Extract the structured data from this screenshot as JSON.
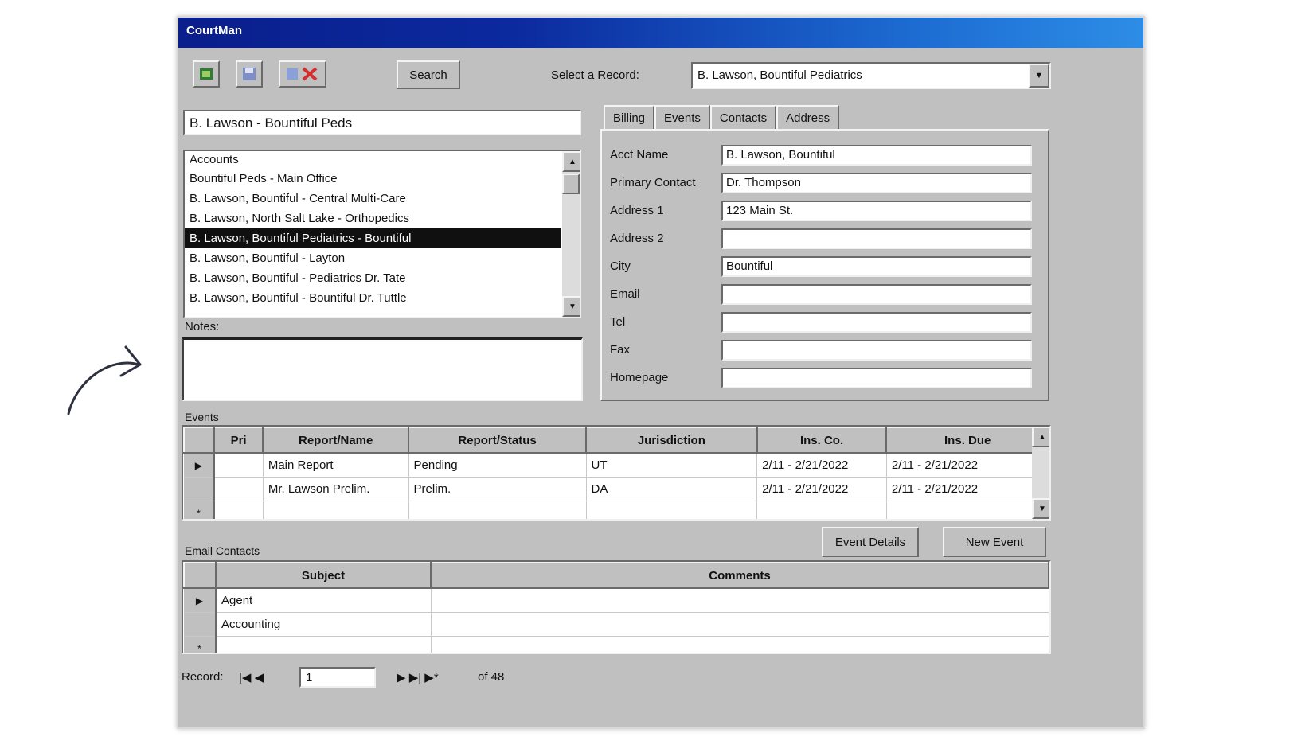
{
  "window": {
    "title": "CourtMan"
  },
  "toolbar": {
    "icons": [
      "new-record-icon",
      "save-icon",
      "delete-icon"
    ],
    "search_button": "Search",
    "select_label": "Select a Record:",
    "select_value": "B. Lawson, Bountiful Pediatrics"
  },
  "left_panel": {
    "name_value": "B. Lawson - Bountiful Peds",
    "list_header": "Accounts",
    "list_items": [
      "Bountiful Peds - Main Office",
      "B. Lawson, Bountiful - Central Multi-Care",
      "B. Lawson, North Salt Lake - Orthopedics",
      "B. Lawson, Bountiful Pediatrics - Bountiful",
      "B. Lawson, Bountiful - Layton",
      "B. Lawson, Bountiful - Pediatrics Dr. Tate",
      "B. Lawson, Bountiful - Bountiful Dr. Tuttle"
    ],
    "selected_index": 3,
    "notes_label": "Notes:",
    "notes_value": ""
  },
  "tabs": [
    "Billing",
    "Events",
    "Contacts",
    "Address"
  ],
  "contact_form": {
    "fields": [
      {
        "label": "Acct Name",
        "value": "B. Lawson, Bountiful"
      },
      {
        "label": "Primary Contact",
        "value": "Dr. Thompson"
      },
      {
        "label": "Address 1",
        "value": "123 Main St."
      },
      {
        "label": "Address 2",
        "value": ""
      },
      {
        "label": "City",
        "value": "Bountiful"
      },
      {
        "label": "Email",
        "value": ""
      },
      {
        "label": "Tel",
        "value": ""
      },
      {
        "label": "Fax",
        "value": ""
      },
      {
        "label": "Homepage",
        "value": ""
      }
    ]
  },
  "events": {
    "label": "Events",
    "columns": [
      "Pri",
      "Report/Name",
      "Report/Status",
      "Jurisdiction",
      "Ins. Co.",
      "Ins. Due"
    ],
    "rows": [
      {
        "marker": "▶",
        "pri": "",
        "name": "Main Report",
        "status": "Pending",
        "jurisdiction": "UT",
        "ins_co": "2/11 - 2/21/2022",
        "ins_due": "2/11 - 2/21/2022"
      },
      {
        "marker": "",
        "pri": "",
        "name": "Mr. Lawson Prelim.",
        "status": "Prelim.",
        "jurisdiction": "DA",
        "ins_co": "2/11 - 2/21/2022",
        "ins_due": "2/11 - 2/21/2022"
      },
      {
        "marker": "*",
        "pri": "",
        "name": "",
        "status": "",
        "jurisdiction": "",
        "ins_co": "",
        "ins_due": ""
      }
    ],
    "buttons": [
      "Event Details",
      "New Event"
    ]
  },
  "email_contacts": {
    "label": "Email Contacts",
    "columns": [
      "Subject",
      "Comments"
    ],
    "rows": [
      {
        "marker": "▶",
        "subject": "Agent",
        "comments": ""
      },
      {
        "marker": "",
        "subject": "Accounting",
        "comments": ""
      },
      {
        "marker": "*",
        "subject": "",
        "comments": ""
      }
    ]
  },
  "navigator": {
    "label": "Record:",
    "prev_buttons": "|◀ ◀",
    "record_value": "1",
    "next_buttons": "▶ ▶| ▶*",
    "of_text": "of 48"
  },
  "annotation": {
    "arrow_color": "#2e3140"
  }
}
